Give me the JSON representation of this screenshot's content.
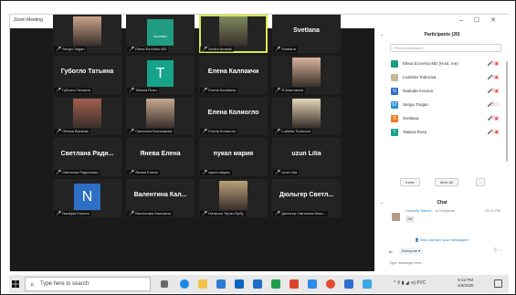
{
  "window": {
    "title": "Zoom Meeting",
    "minimize_glyph": "–",
    "maximize_glyph": "☐",
    "close_glyph": "✕"
  },
  "gallery": {
    "tiles": [
      {
        "big": "",
        "label": "Sergiu Tolgan",
        "muted": true,
        "kind": "photo",
        "photo_color": "#c9a48a"
      },
      {
        "big": "",
        "label": "Elena EcoVisio MD",
        "muted": true,
        "kind": "logo",
        "logo_text": "ecovisio",
        "logo_color": "#1f9c82"
      },
      {
        "big": "",
        "label": "Dmitrii Anatolii",
        "muted": true,
        "kind": "photo",
        "photo_color": "#7e8a5f",
        "active": true
      },
      {
        "big": "Svetlana",
        "label": "Svetlana",
        "muted": true,
        "kind": "name"
      },
      {
        "big": "Губогло Татьяна",
        "label": "Губогло Татьяна",
        "muted": true,
        "kind": "name"
      },
      {
        "big": "",
        "label": "Tatiana Rusu",
        "muted": true,
        "kind": "avatar",
        "letter": "T",
        "avatar_color": "#17a38a"
      },
      {
        "big": "Елена Калпакчи",
        "label": "Елена Калпакчи",
        "muted": true,
        "kind": "name"
      },
      {
        "big": "",
        "label": "Я Анастасия",
        "muted": true,
        "kind": "photo",
        "photo_color": "#d9b49a"
      },
      {
        "big": "",
        "label": "Olesea Barabas",
        "muted": true,
        "kind": "photo",
        "photo_color": "#a2604f"
      },
      {
        "big": "",
        "label": "Светлана Волошкина",
        "muted": true,
        "kind": "photo",
        "photo_color": "#c7a88f"
      },
      {
        "big": "Елена Колиогло",
        "label": "Елена Колиогло",
        "muted": true,
        "kind": "name"
      },
      {
        "big": "",
        "label": "Ludmila Todorova",
        "muted": true,
        "kind": "photo",
        "photo_color": "#e3d7b8"
      },
      {
        "big": "Светлана Ради...",
        "label": "Светлана Радионова",
        "muted": true,
        "kind": "name"
      },
      {
        "big": "Янева Елена",
        "label": "Янева Елена",
        "muted": true,
        "kind": "name"
      },
      {
        "big": "пукал мария",
        "label": "пукал мария",
        "muted": true,
        "kind": "name"
      },
      {
        "big": "uzun Lilia",
        "label": "uzun Lilia",
        "muted": true,
        "kind": "name"
      },
      {
        "big": "",
        "label": "Nadejda Koceva",
        "muted": true,
        "kind": "avatar",
        "letter": "N",
        "avatar_color": "#2d6fc4"
      },
      {
        "big": "Валентина Кал...",
        "label": "Валентина Калпакчи",
        "muted": true,
        "kind": "name"
      },
      {
        "big": "",
        "label": "Наталья Терзи-Орбу",
        "muted": true,
        "kind": "photo",
        "photo_color": "#b9a078"
      },
      {
        "big": "Дюльгер Светл...",
        "label": "Дюльгер Светлана Ильи...",
        "muted": true,
        "kind": "name"
      }
    ]
  },
  "participants": {
    "title": "Participants (20)",
    "search_placeholder": "Find a participant",
    "rows": [
      {
        "name": "Elena EcoVisio MD (Host, me)",
        "avatar_color": "#1f9c82",
        "letter": "",
        "icons": "🎤̸ ▣̸"
      },
      {
        "name": "Liudmila Todorova",
        "avatar_color": "#c8b89a",
        "letter": "",
        "icons": "🎤̸ ▣̸"
      },
      {
        "name": "Nadejda Koceva",
        "avatar_color": "#2d6fc4",
        "letter": "N",
        "icons": "🎤̸ ▣̸"
      },
      {
        "name": "Sergiu Torgan",
        "avatar_color": "#2b8fd6",
        "letter": "ST",
        "icons": "🎤̸ ▭"
      },
      {
        "name": "Svetlana",
        "avatar_color": "#f07b2a",
        "letter": "S",
        "icons": "🎤̸ ▣̸"
      },
      {
        "name": "Tatiana Rusu",
        "avatar_color": "#17a38a",
        "letter": "T",
        "icons": "🎤̸ ▣̸"
      }
    ],
    "invite_label": "Invite",
    "mute_all_label": "Mute All",
    "more_label": "..."
  },
  "chat": {
    "title": "Chat",
    "from": "Liudmila Todoro...",
    "to_text": "to Everyone",
    "time": "05:11 PM",
    "message": "OK",
    "who_can_see": "Who can see your messages?",
    "to_label": "to:",
    "to_value": "Everyone ▾",
    "input_placeholder": "Type message here..."
  },
  "taskbar": {
    "search_text": "Type here to search",
    "tray_text": "^ ⚲ ▮ ◢ ⊲) РУС",
    "time": "5:12 PM",
    "date": "4/3/2020"
  },
  "colors": {
    "gallery_bg": "#1a1a1a",
    "tile_bg": "#232323",
    "active_outline": "#d9e84a",
    "mute_red": "#e8473d",
    "link_blue": "#1f79d1"
  }
}
